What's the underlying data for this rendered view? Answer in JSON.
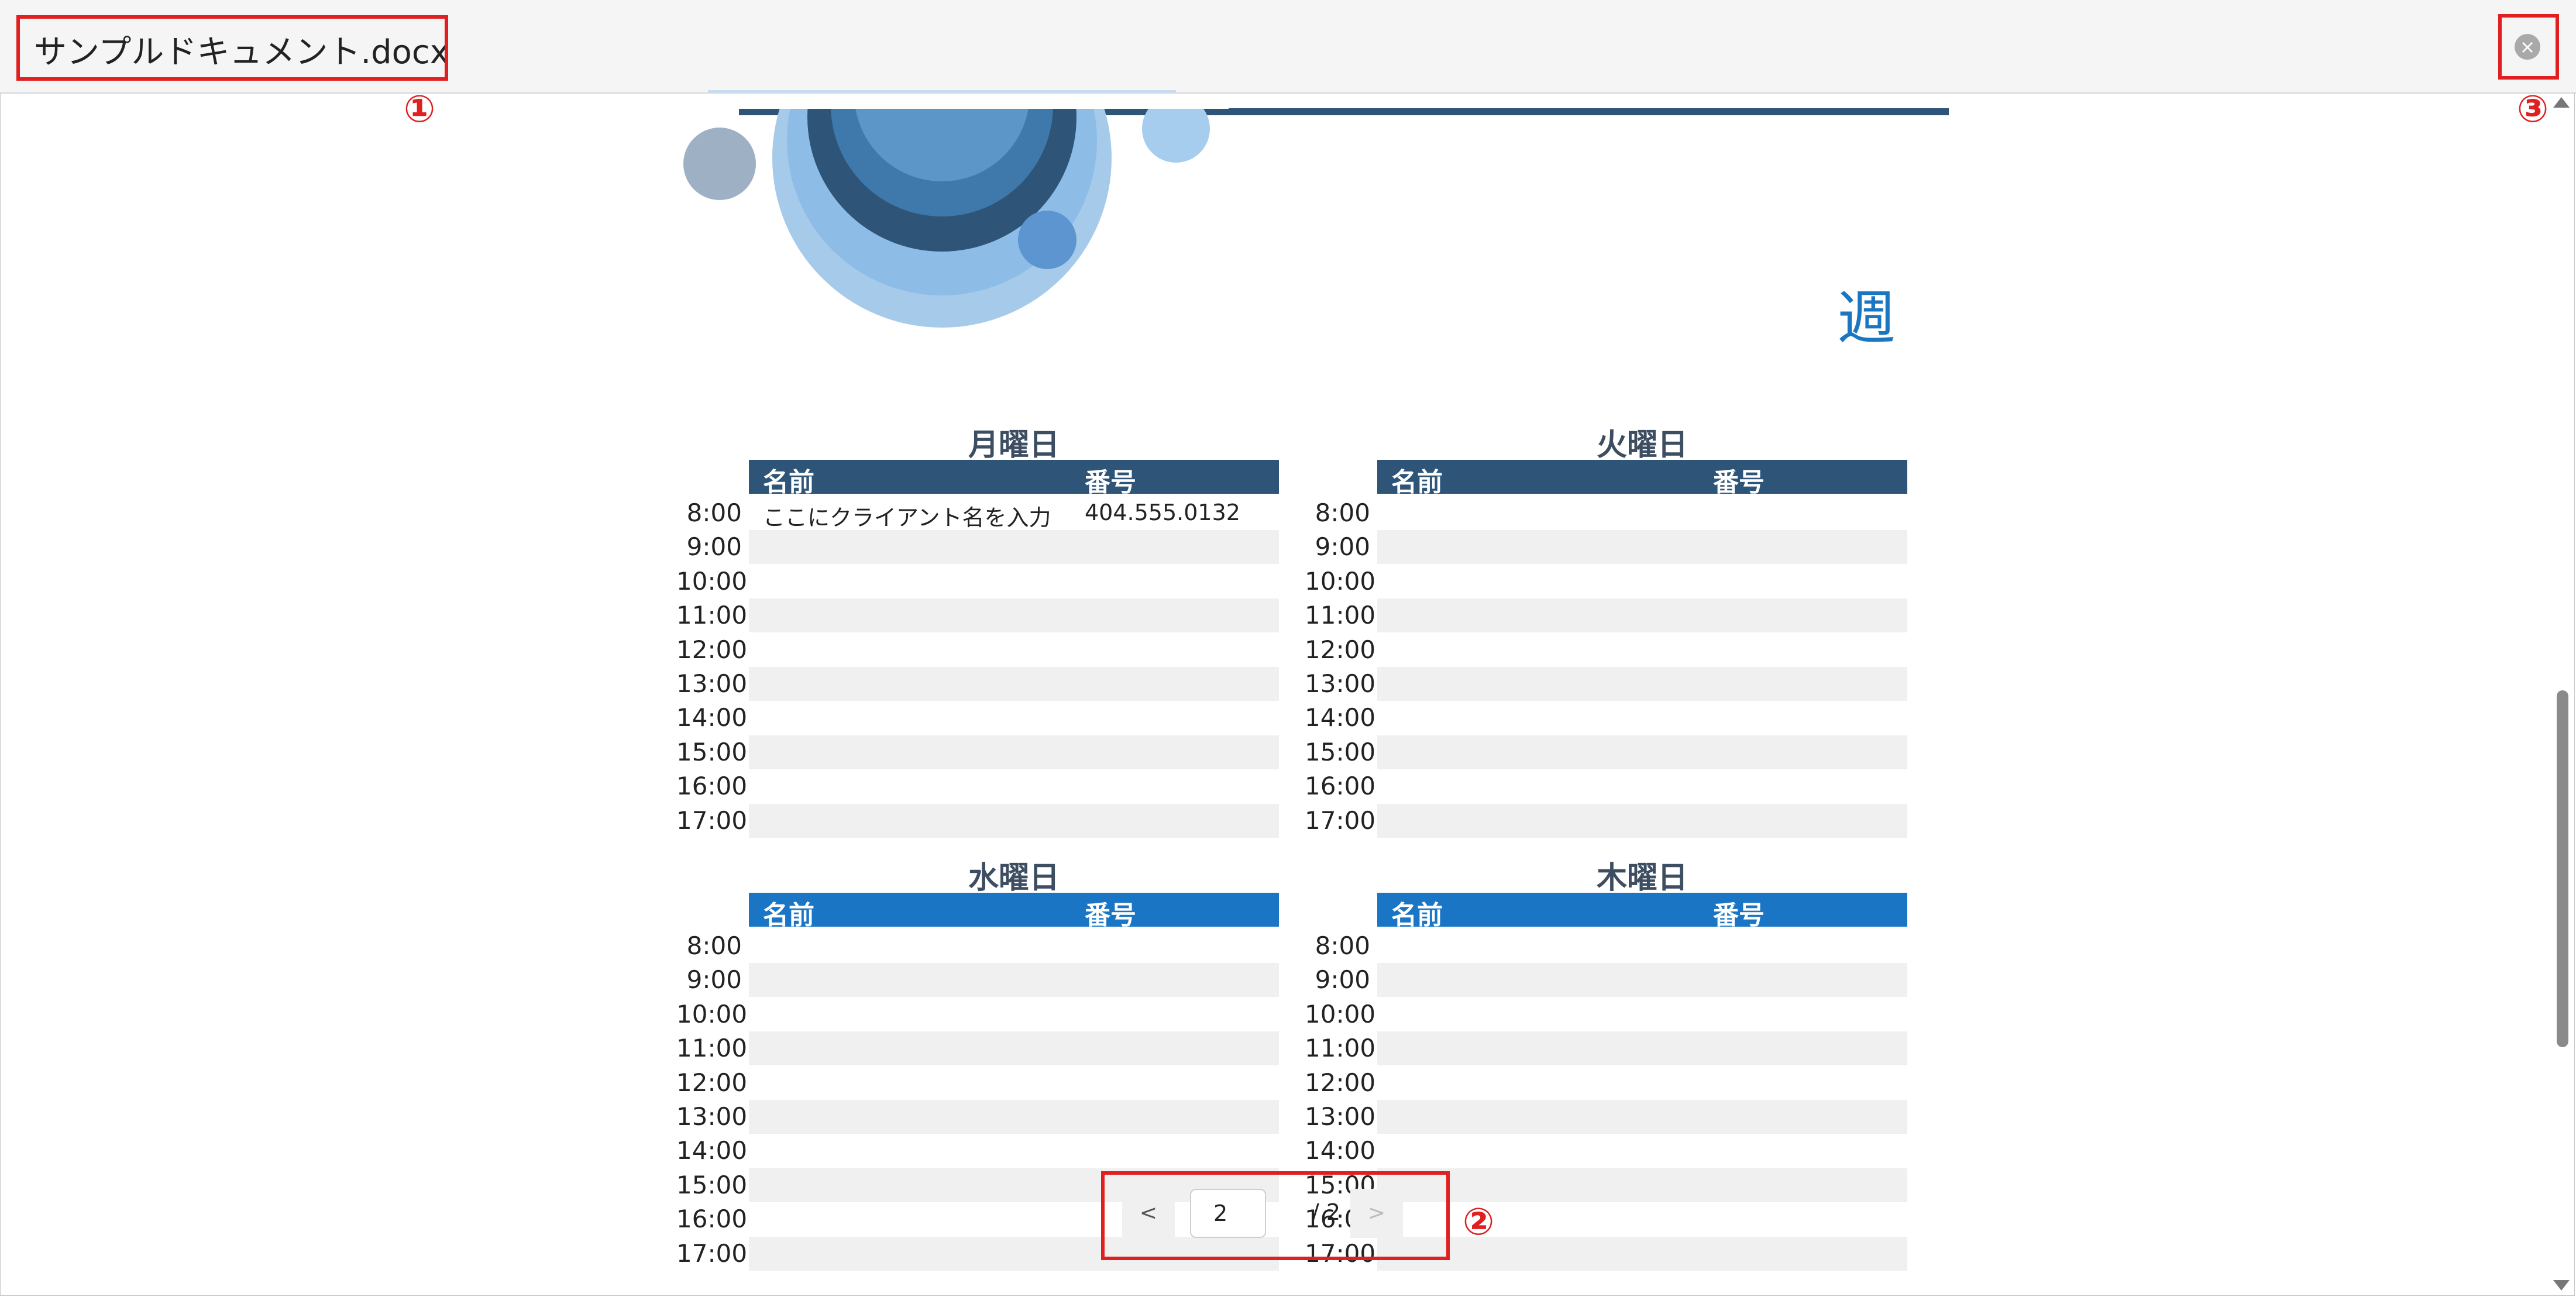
{
  "window": {
    "title": "サンプルドキュメント.docx",
    "close_symbol": "×",
    "close_icon": "close-circle-icon"
  },
  "annotations": {
    "callout_1": "①",
    "callout_2": "②",
    "callout_3": "③",
    "color": "#e02020"
  },
  "document": {
    "week_title": "週",
    "days": [
      {
        "heading": "月曜日",
        "header_color": "#2e5478",
        "col_name": "名前",
        "col_number": "番号",
        "rows": [
          {
            "time": "8:00",
            "name": "ここにクライアント名を入力",
            "number": "404.555.0132"
          },
          {
            "time": "9:00",
            "name": "",
            "number": ""
          },
          {
            "time": "10:00",
            "name": "",
            "number": ""
          },
          {
            "time": "11:00",
            "name": "",
            "number": ""
          },
          {
            "time": "12:00",
            "name": "",
            "number": ""
          },
          {
            "time": "13:00",
            "name": "",
            "number": ""
          },
          {
            "time": "14:00",
            "name": "",
            "number": ""
          },
          {
            "time": "15:00",
            "name": "",
            "number": ""
          },
          {
            "time": "16:00",
            "name": "",
            "number": ""
          },
          {
            "time": "17:00",
            "name": "",
            "number": ""
          }
        ]
      },
      {
        "heading": "火曜日",
        "header_color": "#2e5478",
        "col_name": "名前",
        "col_number": "番号",
        "rows": [
          {
            "time": "8:00",
            "name": "",
            "number": ""
          },
          {
            "time": "9:00",
            "name": "",
            "number": ""
          },
          {
            "time": "10:00",
            "name": "",
            "number": ""
          },
          {
            "time": "11:00",
            "name": "",
            "number": ""
          },
          {
            "time": "12:00",
            "name": "",
            "number": ""
          },
          {
            "time": "13:00",
            "name": "",
            "number": ""
          },
          {
            "time": "14:00",
            "name": "",
            "number": ""
          },
          {
            "time": "15:00",
            "name": "",
            "number": ""
          },
          {
            "time": "16:00",
            "name": "",
            "number": ""
          },
          {
            "time": "17:00",
            "name": "",
            "number": ""
          }
        ]
      },
      {
        "heading": "水曜日",
        "header_color": "#1a76c4",
        "col_name": "名前",
        "col_number": "番号",
        "rows": [
          {
            "time": "8:00",
            "name": "",
            "number": ""
          },
          {
            "time": "9:00",
            "name": "",
            "number": ""
          },
          {
            "time": "10:00",
            "name": "",
            "number": ""
          },
          {
            "time": "11:00",
            "name": "",
            "number": ""
          },
          {
            "time": "12:00",
            "name": "",
            "number": ""
          },
          {
            "time": "13:00",
            "name": "",
            "number": ""
          },
          {
            "time": "14:00",
            "name": "",
            "number": ""
          },
          {
            "time": "15:00",
            "name": "",
            "number": ""
          },
          {
            "time": "16:00",
            "name": "",
            "number": ""
          },
          {
            "time": "17:00",
            "name": "",
            "number": ""
          }
        ]
      },
      {
        "heading": "木曜日",
        "header_color": "#1a76c4",
        "col_name": "名前",
        "col_number": "番号",
        "rows": [
          {
            "time": "8:00",
            "name": "",
            "number": ""
          },
          {
            "time": "9:00",
            "name": "",
            "number": ""
          },
          {
            "time": "10:00",
            "name": "",
            "number": ""
          },
          {
            "time": "11:00",
            "name": "",
            "number": ""
          },
          {
            "time": "12:00",
            "name": "",
            "number": ""
          },
          {
            "time": "13:00",
            "name": "",
            "number": ""
          },
          {
            "time": "14:00",
            "name": "",
            "number": ""
          },
          {
            "time": "15:00",
            "name": "",
            "number": ""
          },
          {
            "time": "16:00",
            "name": "",
            "number": ""
          },
          {
            "time": "17:00",
            "name": "",
            "number": ""
          }
        ]
      }
    ]
  },
  "pager": {
    "prev_label": "<",
    "next_label": ">",
    "current_page": "2",
    "total_label": "/ 2"
  }
}
